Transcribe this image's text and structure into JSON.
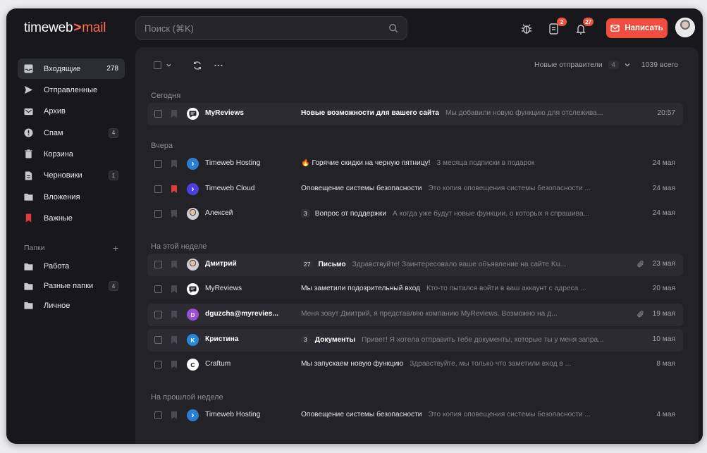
{
  "app": {
    "logo_a": "timeweb",
    "logo_caret": ">",
    "logo_b": "mail"
  },
  "header": {
    "search_placeholder": "Поиск (⌘K)",
    "badge_mail": "2",
    "badge_notifications": "27",
    "compose_label": "Написать"
  },
  "sidebar": {
    "items": [
      {
        "label": "Входящие",
        "count": "278",
        "icon": "inbox-icon"
      },
      {
        "label": "Отправленные",
        "count": "",
        "icon": "send-icon"
      },
      {
        "label": "Архив",
        "count": "",
        "icon": "archive-icon"
      },
      {
        "label": "Спам",
        "count": "4",
        "icon": "spam-icon"
      },
      {
        "label": "Корзина",
        "count": "",
        "icon": "trash-icon"
      },
      {
        "label": "Черновики",
        "count": "1",
        "icon": "drafts-icon"
      },
      {
        "label": "Вложения",
        "count": "",
        "icon": "attachments-icon"
      },
      {
        "label": "Важные",
        "count": "",
        "icon": "bookmark-icon"
      }
    ],
    "folders_title": "Папки",
    "folders_add": "+",
    "folders": [
      {
        "label": "Работа",
        "count": ""
      },
      {
        "label": "Разные папки",
        "count": "4"
      },
      {
        "label": "Личное",
        "count": ""
      }
    ]
  },
  "toolbar": {
    "new_senders_label": "Новые отправители",
    "new_senders_count": "4",
    "total": "1039 всего"
  },
  "groups": [
    {
      "label": "Сегодня"
    },
    {
      "label": "Вчера"
    },
    {
      "label": "На этой неделе"
    },
    {
      "label": "На прошлой неделе"
    }
  ],
  "emails": [
    {
      "sender": "MyReviews",
      "avatar": "",
      "avatar_color": "#ffffff",
      "avatar_icon": "chat-icon",
      "unread": true,
      "flag": false,
      "thread": "",
      "subject": "Новые возможности для вашего сайта",
      "preview": "Мы добавили новую функцию для отслежива...",
      "attachment": false,
      "date": "20:57"
    },
    {
      "sender": "Timeweb Hosting",
      "avatar": "›",
      "avatar_color": "#2a7fd4",
      "avatar_icon": "chevron-right-icon",
      "unread": false,
      "flag": false,
      "thread": "",
      "subject": "🔥 Горячие скидки на черную пятницу!",
      "preview": "3 месяца подписки в подарок",
      "attachment": false,
      "date": "24 мая"
    },
    {
      "sender": "Timeweb Cloud",
      "avatar": "›",
      "avatar_color": "#4b3fe0",
      "avatar_icon": "chevron-right-icon",
      "unread": false,
      "flag": true,
      "thread": "",
      "subject": "Оповещение системы безопасности",
      "preview": "Это копия оповещения системы безопасности ...",
      "attachment": false,
      "date": "24 мая"
    },
    {
      "sender": "Алексей",
      "avatar": "",
      "avatar_color": "#9a9a9a",
      "avatar_icon": "photo-avatar",
      "unread": false,
      "flag": false,
      "thread": "3",
      "subject": "Вопрос от поддержки",
      "preview": "А когда уже будут новые функции, о которых я спрашива...",
      "attachment": false,
      "date": "24 мая"
    },
    {
      "sender": "Дмитрий",
      "avatar": "",
      "avatar_color": "#b08a70",
      "avatar_icon": "photo-avatar",
      "unread": true,
      "flag": false,
      "thread": "27",
      "subject": "Письмо",
      "preview": "Здравствуйте! Заинтересовало ваше объявление на сайте Ku...",
      "attachment": true,
      "date": "23 мая"
    },
    {
      "sender": "MyReviews",
      "avatar": "",
      "avatar_color": "#ffffff",
      "avatar_icon": "chat-icon",
      "unread": false,
      "flag": false,
      "thread": "",
      "subject": "Мы заметили подозрительный вход",
      "preview": "Кто-то пытался войти в ваш аккаунт с адреса ...",
      "attachment": false,
      "date": "20 мая"
    },
    {
      "sender": "dguzcha@myrevies...",
      "avatar": "D",
      "avatar_color": "#9b4fd0",
      "avatar_icon": "",
      "unread": true,
      "flag": false,
      "thread": "",
      "subject": "",
      "preview": "Меня зовут Дмитрий, я представляю компанию MyReviews. Возможно на д...",
      "attachment": true,
      "date": "19 мая"
    },
    {
      "sender": "Кристина",
      "avatar": "K",
      "avatar_color": "#2a86d8",
      "avatar_icon": "",
      "unread": true,
      "flag": false,
      "thread": "3",
      "subject": "Документы",
      "preview": "Привет! Я хотела отправить тебе документы, которые ты у меня запра...",
      "attachment": false,
      "date": "10 мая"
    },
    {
      "sender": "Craftum",
      "avatar": "C",
      "avatar_color": "#ffffff",
      "avatar_icon": "",
      "unread": false,
      "flag": false,
      "thread": "",
      "subject": "Мы запускаем новую функцию",
      "preview": "Здравствуйте, мы только что заметили вход в ...",
      "attachment": false,
      "date": "8 мая"
    },
    {
      "sender": "Timeweb Hosting",
      "avatar": "›",
      "avatar_color": "#2a7fd4",
      "avatar_icon": "chevron-right-icon",
      "unread": false,
      "flag": false,
      "thread": "",
      "subject": "Оповещение системы безопасности",
      "preview": "Это копия оповещения системы безопасности ...",
      "attachment": false,
      "date": "4 мая"
    }
  ],
  "colors": {
    "accent": "#ef4e3e",
    "flag_red": "#e23a3a",
    "background": "#18181c",
    "panel": "#222227"
  }
}
